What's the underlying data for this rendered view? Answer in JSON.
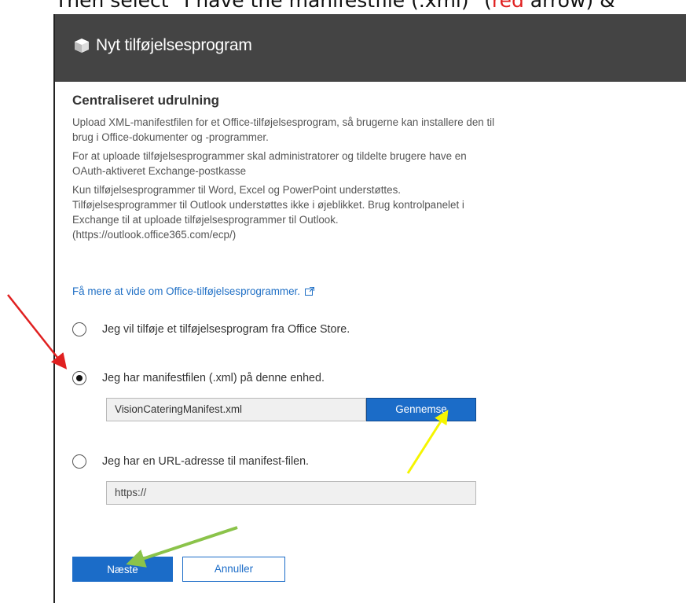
{
  "caption": {
    "prefix": "Then select \"I have the manifestfile (.xml)\" (",
    "red_word": "red",
    "suffix": " arrow) &"
  },
  "dialog": {
    "title": "Nyt tilføjelsesprogram",
    "section_title": "Centraliseret udrulning",
    "paragraphs": [
      "Upload XML-manifestfilen for et Office-tilføjelsesprogram, så brugerne kan installere den til brug i Office-dokumenter og -programmer.",
      "For at uploade tilføjelsesprogrammer skal administratorer og tildelte brugere have en OAuth-aktiveret Exchange-postkasse",
      "Kun tilføjelsesprogrammer til Word, Excel og PowerPoint understøttes. Tilføjelsesprogrammer til Outlook understøttes ikke i øjeblikket. Brug kontrolpanelet i Exchange til at uploade tilføjelsesprogrammer til Outlook. (https://outlook.office365.com/ecp/)"
    ],
    "learn_more_link": "Få mere at vide om Office-tilføjelsesprogrammer.",
    "options": [
      {
        "label": "Jeg vil tilføje et tilføjelsesprogram fra Office Store.",
        "selected": false
      },
      {
        "label": "Jeg har manifestfilen (.xml) på denne enhed.",
        "selected": true
      },
      {
        "label": "Jeg har en URL-adresse til manifest-filen.",
        "selected": false
      }
    ],
    "file_input_value": "VisionCateringManifest.xml",
    "browse_button": "Gennemse",
    "url_input_value": "https://",
    "next_button": "Næste",
    "cancel_button": "Annuller"
  },
  "colors": {
    "header_bg": "#444444",
    "accent_blue": "#1b6cc8",
    "arrow_red": "#e02020",
    "arrow_yellow": "#f5f500",
    "arrow_green": "#8bc34a"
  },
  "annotations": {
    "arrows": [
      {
        "color": "red",
        "points_to": "manifest-file-radio"
      },
      {
        "color": "yellow",
        "points_to": "browse-button"
      },
      {
        "color": "green",
        "points_to": "next-button"
      }
    ]
  }
}
